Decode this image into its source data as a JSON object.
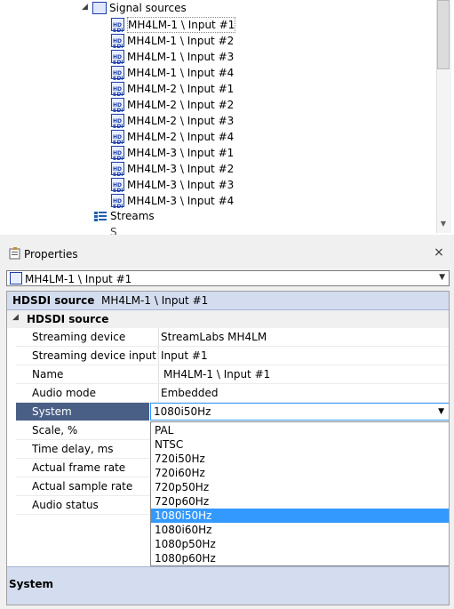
{
  "tree": {
    "group_label": "Signal sources",
    "items": [
      "MH4LM-1 \\ Input #1",
      "MH4LM-1 \\ Input #2",
      "MH4LM-1 \\ Input #3",
      "MH4LM-1 \\ Input #4",
      "MH4LM-2 \\ Input #1",
      "MH4LM-2 \\ Input #2",
      "MH4LM-2 \\ Input #3",
      "MH4LM-2 \\ Input #4",
      "MH4LM-3 \\ Input #1",
      "MH4LM-3 \\ Input #2",
      "MH4LM-3 \\ Input #3",
      "MH4LM-3 \\ Input #4"
    ],
    "streams_label": "Streams",
    "partial_label": "S..."
  },
  "properties": {
    "title": "Properties",
    "selected_object": "MH4LM-1 \\ Input #1",
    "grid_title_type": "HDSDI source",
    "grid_title_name": "MH4LM-1 \\ Input #1",
    "category": "HDSDI source",
    "rows": [
      {
        "name": "Streaming device",
        "value": "StreamLabs MH4LM"
      },
      {
        "name": "Streaming device input",
        "value": "Input #1"
      },
      {
        "name": "Name",
        "value": "MH4LM-1 \\ Input #1"
      },
      {
        "name": "Audio mode",
        "value": "Embedded"
      },
      {
        "name": "System",
        "value": "1080i50Hz"
      },
      {
        "name": "Scale, %",
        "value": ""
      },
      {
        "name": "Time delay, ms",
        "value": ""
      },
      {
        "name": "Actual frame rate",
        "value": ""
      },
      {
        "name": "Actual sample rate",
        "value": ""
      },
      {
        "name": "Audio status",
        "value": ""
      }
    ],
    "system_options": [
      "PAL",
      "NTSC",
      "720i50Hz",
      "720i60Hz",
      "720p50Hz",
      "720p60Hz",
      "1080i50Hz",
      "1080i60Hz",
      "1080p50Hz",
      "1080p60Hz"
    ],
    "system_selected": "1080i50Hz",
    "description_title": "System"
  }
}
